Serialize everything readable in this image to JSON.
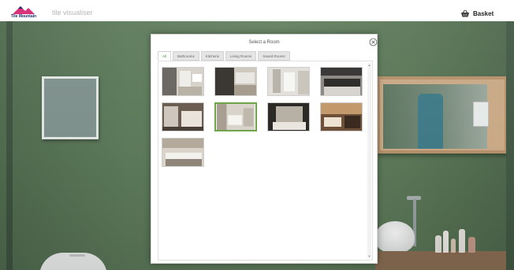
{
  "header": {
    "logo_text": "Tile Mountain",
    "app_title": "tile visualiser",
    "basket_label": "Basket",
    "basket_icon": "basket-icon"
  },
  "modal": {
    "title": "Select a Room",
    "close_icon": "close-circle-icon",
    "tabs": [
      "All",
      "Bathrooms",
      "Kitchens",
      "Living Rooms",
      "Saved Rooms"
    ],
    "active_tab": "All",
    "rooms": [
      {
        "kind": "bathroom"
      },
      {
        "kind": "bathroom"
      },
      {
        "kind": "bathroom"
      },
      {
        "kind": "kitchen"
      },
      {
        "kind": "bathroom"
      },
      {
        "kind": "bathroom",
        "selected": true
      },
      {
        "kind": "living"
      },
      {
        "kind": "living"
      },
      {
        "kind": "kitchen"
      }
    ]
  },
  "colors": {
    "accent_green": "#6ea54a",
    "wall_green": "#5d7a5b",
    "logo_pink": "#d8327a",
    "logo_navy": "#1a2a66"
  }
}
